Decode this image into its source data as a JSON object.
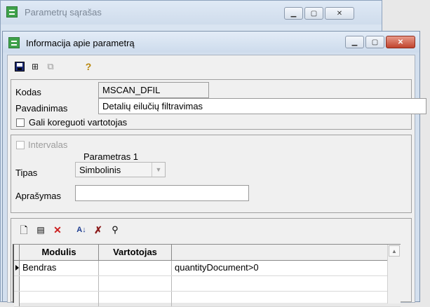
{
  "background_window": {
    "title": "Parametrų sąrašas"
  },
  "window": {
    "title": "Informacija apie parametrą",
    "controls": {
      "minimize": "▭",
      "maximize": "▢",
      "close": "✕"
    }
  },
  "toolbar": {
    "icons": [
      "save-icon",
      "tree-link-icon",
      "copy-icon",
      "help-icon"
    ],
    "help_glyph": "?"
  },
  "form": {
    "kodas_label": "Kodas",
    "kodas_value": "MSCAN_DFIL",
    "pavadinimas_label": "Pavadinimas",
    "pavadinimas_value": "Detalių eilučių filtravimas",
    "gali_koreguoti_label": "Gali koreguoti vartotojas",
    "gali_koreguoti_checked": false
  },
  "params": {
    "intervalas_label": "Intervalas",
    "intervalas_checked": false,
    "parametras_heading": "Parametras 1",
    "tipas_label": "Tipas",
    "tipas_value": "Simbolinis",
    "aprasymas_label": "Aprašymas",
    "aprasymas_value": ""
  },
  "grid_toolbar": {
    "icons": [
      "new-doc-icon",
      "edit-doc-icon",
      "delete-icon",
      "sort-az-icon",
      "clear-filter-icon",
      "find-icon"
    ]
  },
  "grid": {
    "columns": [
      "Modulis",
      "Vartotojas",
      ""
    ],
    "rows": [
      {
        "modulis": "Bendras",
        "vartotojas": "",
        "value": "quantityDocument>0",
        "current": true
      },
      {
        "modulis": "",
        "vartotojas": "",
        "value": ""
      },
      {
        "modulis": "",
        "vartotojas": "",
        "value": ""
      }
    ]
  }
}
